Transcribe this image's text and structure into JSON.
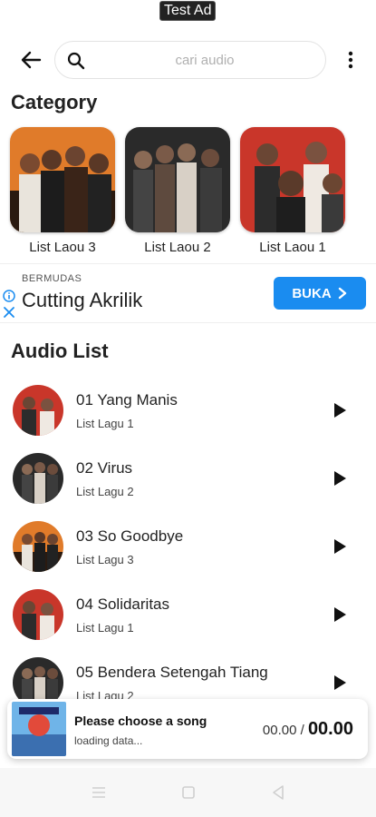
{
  "search": {
    "placeholder": "cari audio"
  },
  "categories": {
    "title": "Category",
    "items": [
      {
        "label": "List Laou 3"
      },
      {
        "label": "List Laou 2"
      },
      {
        "label": "List Laou 1"
      }
    ]
  },
  "ad": {
    "tag": "Test Ad",
    "brand": "BERMUDAS",
    "headline": "Cutting Akrilik",
    "cta": "BUKA"
  },
  "audio": {
    "title": "Audio List",
    "items": [
      {
        "name": "01 Yang Manis",
        "list": "List Lagu 1"
      },
      {
        "name": "02 Virus",
        "list": "List Lagu 2"
      },
      {
        "name": "03 So Goodbye",
        "list": "List Lagu 3"
      },
      {
        "name": "04 Solidaritas",
        "list": "List Lagu 1"
      },
      {
        "name": "05 Bendera Setengah Tiang",
        "list": "List Lagu 2"
      }
    ]
  },
  "player": {
    "title": "Please choose a song",
    "status": "loading data...",
    "current": "00.00 /",
    "total": "00.00"
  },
  "colors": {
    "accent": "#1a8cf0"
  }
}
